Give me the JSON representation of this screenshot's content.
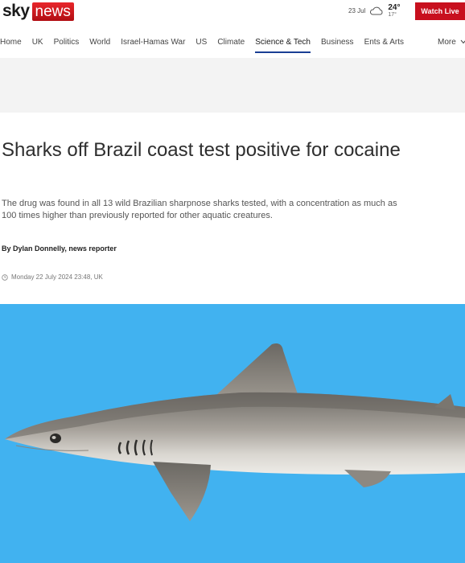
{
  "header": {
    "logo_sky": "sky",
    "logo_news": "news",
    "weather_date": "23 Jul",
    "weather_high": "24°",
    "weather_low": "17°",
    "watch_live": "Watch Live"
  },
  "nav": {
    "items": [
      "Home",
      "UK",
      "Politics",
      "World",
      "Israel-Hamas War",
      "US",
      "Climate",
      "Science & Tech",
      "Business",
      "Ents & Arts"
    ],
    "active": "Science & Tech",
    "more": "More"
  },
  "article": {
    "title": "Sharks off Brazil coast test positive for cocaine",
    "standfirst": "The drug was found in all 13 wild Brazilian sharpnose sharks tested, with a concentration as much as 100 times higher than previously reported for other aquatic creatures.",
    "byline": "By Dylan Donnelly, news reporter",
    "date": "Monday 22 July 2024 23:48, UK"
  },
  "colors": {
    "brand_red": "#c8101e",
    "nav_active": "#1a3e94",
    "image_bg": "#41b2f0"
  }
}
